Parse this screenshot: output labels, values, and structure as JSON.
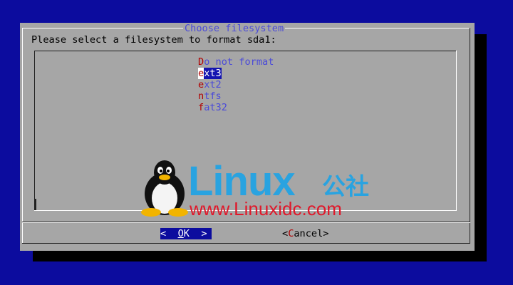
{
  "dialog": {
    "title": "Choose filesystem",
    "prompt": "Please select a filesystem to format sda1:"
  },
  "options": [
    {
      "hot": "D",
      "rest": "o not format",
      "selected": false
    },
    {
      "hot": "e",
      "rest": "xt3",
      "selected": true
    },
    {
      "hot": "e",
      "rest": "xt2",
      "selected": false
    },
    {
      "hot": "n",
      "rest": "tfs",
      "selected": false
    },
    {
      "hot": "f",
      "rest": "at32",
      "selected": false
    }
  ],
  "buttons": {
    "ok": {
      "left": "<",
      "space1": "  ",
      "hot": "O",
      "rest": "K",
      "space2": "  ",
      "right": ">"
    },
    "cancel": {
      "left": "<",
      "hot": "C",
      "rest": "ancel",
      "right": ">"
    }
  },
  "watermark": {
    "brand": "Linux",
    "brand_cn": "公社",
    "url": "www.Linuxidc.com",
    "logo_icon": "tux-penguin-icon"
  },
  "colors": {
    "screen_bg": "#0c0c9e",
    "dialog_bg": "#a6a6a6",
    "text_blue": "#4b4bd8",
    "hotkey_red": "#b00000",
    "watermark_blue": "#29a3e0",
    "watermark_red": "#e0182a"
  }
}
